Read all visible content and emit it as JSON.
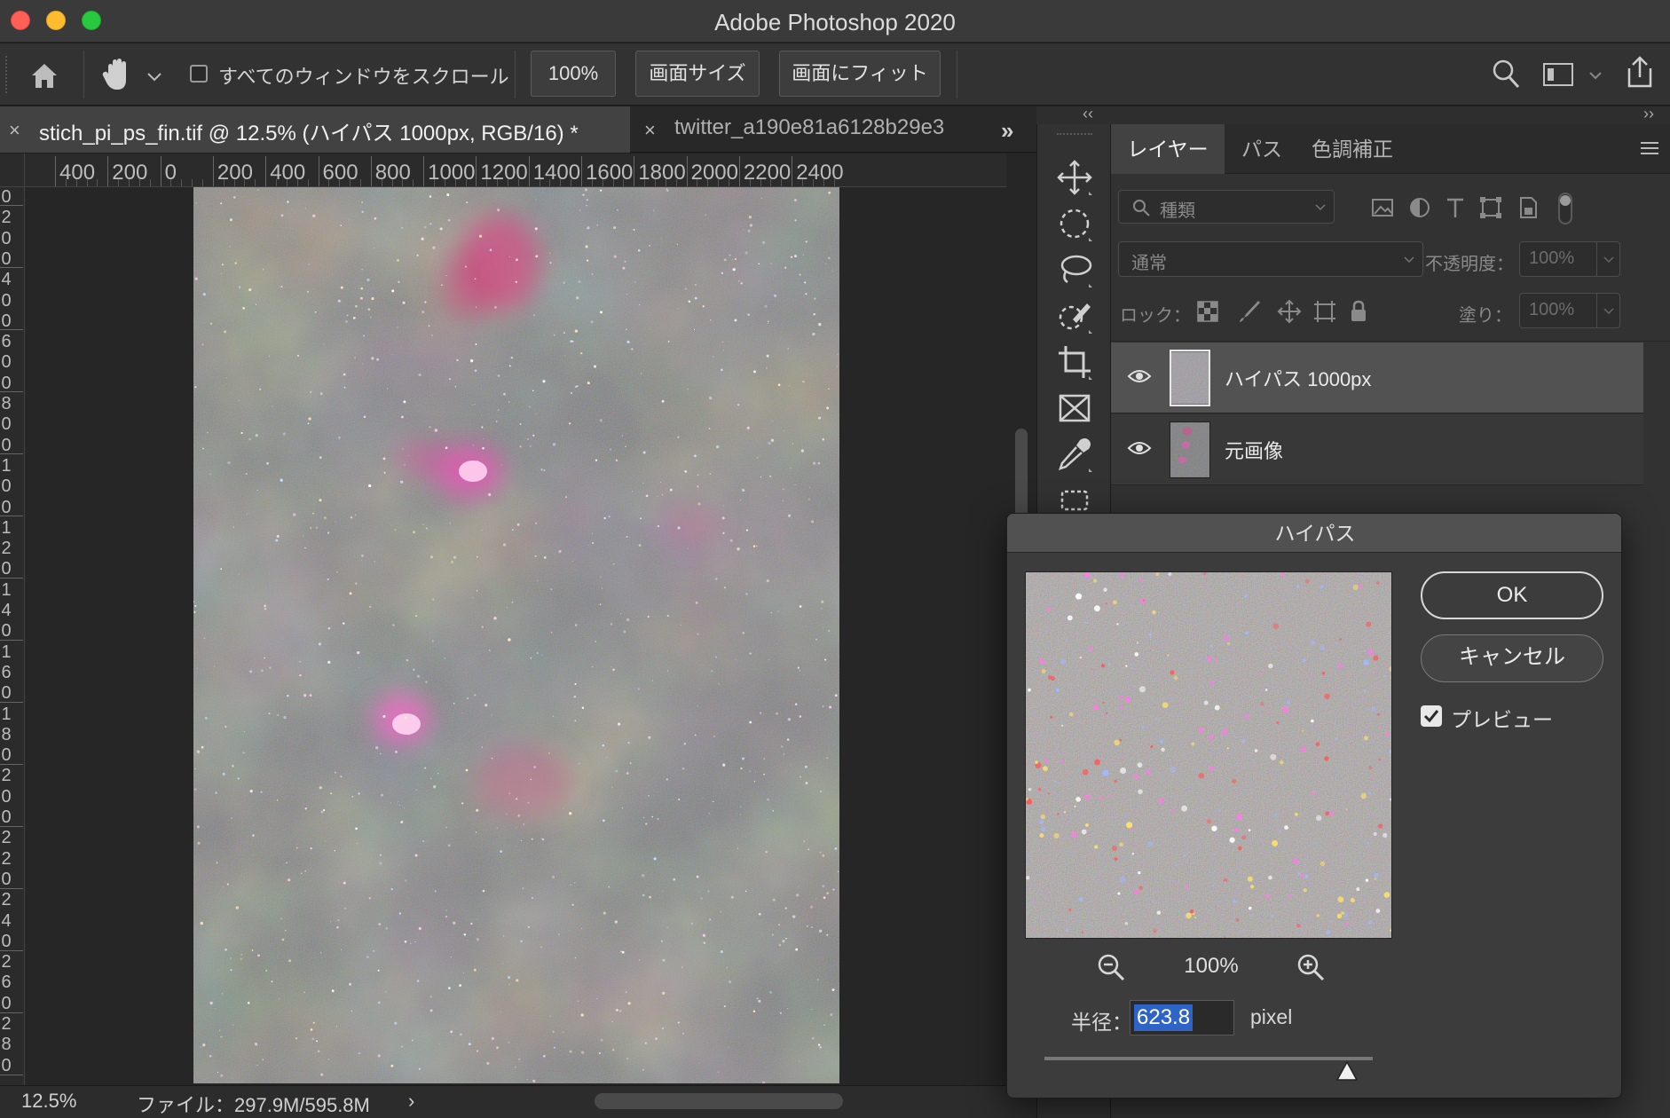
{
  "app": {
    "title": "Adobe Photoshop 2020"
  },
  "options_bar": {
    "scroll_all_label": "すべてのウィンドウをスクロール",
    "zoom_button": "100%",
    "fit_screen_button": "画面サイズ",
    "fill_screen_button": "画面にフィット"
  },
  "tabs": [
    {
      "close": "×",
      "label": "stich_pi_ps_fin.tif @ 12.5% (ハイパス 1000px, RGB/16) *",
      "active": true
    },
    {
      "close": "×",
      "label": "twitter_a190e81a6128b29e3",
      "active": false
    }
  ],
  "tabs_more": "»",
  "ruler_h": [
    "400",
    "200",
    "0",
    "200",
    "400",
    "600",
    "800",
    "1000",
    "1200",
    "1400",
    "1600",
    "1800",
    "2000",
    "2200",
    "2400"
  ],
  "ruler_v": [
    "0",
    "2",
    "0",
    "0",
    "4",
    "0",
    "0",
    "6",
    "0",
    "0",
    "8",
    "0",
    "0",
    "1",
    "0",
    "0",
    "1",
    "2",
    "0",
    "1",
    "4",
    "0",
    "1",
    "6",
    "0",
    "1",
    "8",
    "0",
    "2",
    "0",
    "0",
    "2",
    "2",
    "0",
    "2",
    "4",
    "0",
    "2",
    "6",
    "0",
    "2",
    "8",
    "0"
  ],
  "status": {
    "zoom": "12.5%",
    "file": "ファイル：297.9M/595.8M",
    "arrow": "›"
  },
  "panel": {
    "collapse_left": "‹‹",
    "collapse_right": "››",
    "tabs": [
      {
        "label": "レイヤー",
        "active": true
      },
      {
        "label": "パス",
        "active": false
      },
      {
        "label": "色調補正",
        "active": false
      }
    ],
    "kind_placeholder": "種類",
    "blend_mode": "通常",
    "opacity_label": "不透明度：",
    "opacity_value": "100%",
    "lock_label": "ロック：",
    "fill_label": "塗り：",
    "fill_value": "100%",
    "layers": [
      {
        "name": "ハイパス 1000px",
        "visible": true,
        "selected": true
      },
      {
        "name": "元画像",
        "visible": true,
        "selected": false
      }
    ]
  },
  "dialog": {
    "title": "ハイパス",
    "ok": "OK",
    "cancel": "キャンセル",
    "preview_label": "プレビュー",
    "preview_checked": true,
    "zoom": "100%",
    "radius_label": "半径：",
    "radius_value": "623.8",
    "radius_unit": "pixel"
  },
  "colors": {
    "accent": "#2d64c5",
    "close": "#fe5f57",
    "minimize": "#febc2e",
    "maximize": "#28c840"
  }
}
